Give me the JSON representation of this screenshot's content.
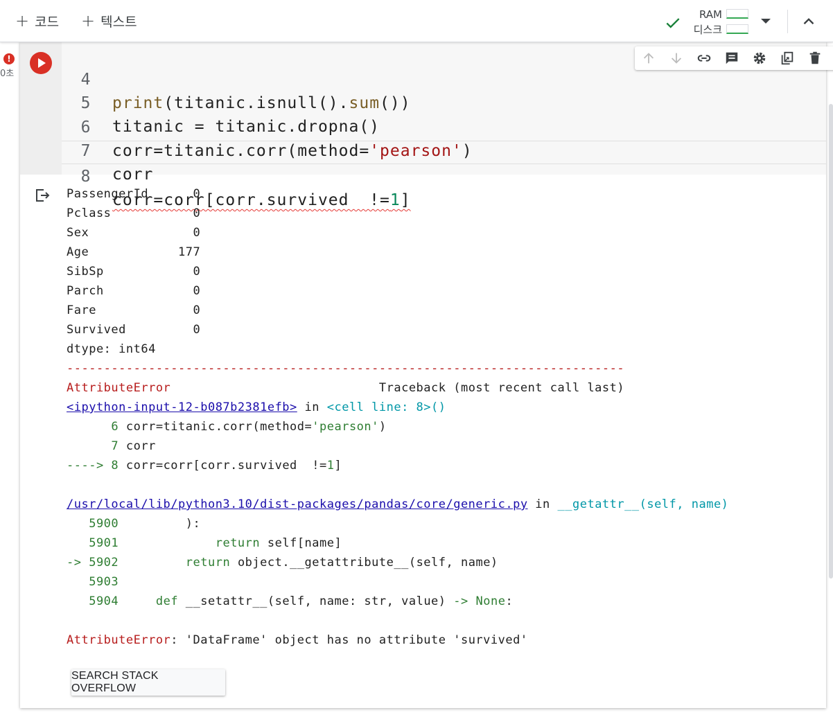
{
  "toolbar": {
    "add_code_label": "코드",
    "add_text_label": "텍스트",
    "ram_label": "RAM",
    "disk_label": "디스크"
  },
  "cell_status": {
    "error_badge": "!",
    "exec_time": "0초"
  },
  "code_lines": [
    {
      "num": "4"
    },
    {
      "num": "5"
    },
    {
      "num": "6"
    },
    {
      "num": "7"
    },
    {
      "num": "8"
    }
  ],
  "output": {
    "series": [
      {
        "name": "PassengerId",
        "value": "0"
      },
      {
        "name": "Pclass",
        "value": "0"
      },
      {
        "name": "Sex",
        "value": "0"
      },
      {
        "name": "Age",
        "value": "177"
      },
      {
        "name": "SibSp",
        "value": "0"
      },
      {
        "name": "Parch",
        "value": "0"
      },
      {
        "name": "Fare",
        "value": "0"
      },
      {
        "name": "Survived",
        "value": "0"
      }
    ],
    "dtype_line": "dtype: int64",
    "separator": "---------------------------------------------------------------------------",
    "error_name": "AttributeError",
    "traceback_header": "Traceback (most recent call last)",
    "frame1_link": "<ipython-input-12-b087b2381efb>",
    "frame1_in": " in ",
    "frame1_func": "<cell line: 8>()",
    "frame2_link": "/usr/local/lib/python3.10/dist-packages/pandas/core/generic.py",
    "frame2_in": " in ",
    "frame2_func": "__getattr__(self, name)",
    "error_message": ": 'DataFrame' object has no attribute 'survived'"
  },
  "stack_overflow_button": "SEARCH STACK OVERFLOW",
  "colors": {
    "error_red": "#d93025",
    "accent_green": "#34a853"
  },
  "icons": [
    "plus-icon",
    "check-icon",
    "chevron-down-icon",
    "chevron-up-icon",
    "arrow-up-icon",
    "arrow-down-icon",
    "link-icon",
    "comment-icon",
    "gear-icon",
    "mirror-cell-icon",
    "trash-icon",
    "more-vert-icon",
    "output-icon"
  ]
}
